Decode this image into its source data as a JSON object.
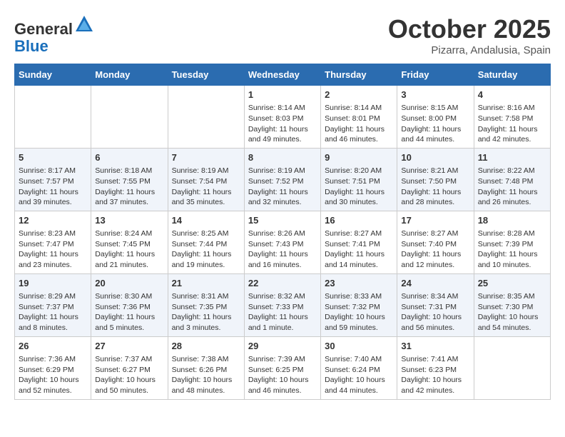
{
  "header": {
    "logo_general": "General",
    "logo_blue": "Blue",
    "month_title": "October 2025",
    "location": "Pizarra, Andalusia, Spain"
  },
  "weekdays": [
    "Sunday",
    "Monday",
    "Tuesday",
    "Wednesday",
    "Thursday",
    "Friday",
    "Saturday"
  ],
  "weeks": [
    [
      {
        "day": "",
        "info": ""
      },
      {
        "day": "",
        "info": ""
      },
      {
        "day": "",
        "info": ""
      },
      {
        "day": "1",
        "info": "Sunrise: 8:14 AM\nSunset: 8:03 PM\nDaylight: 11 hours and 49 minutes."
      },
      {
        "day": "2",
        "info": "Sunrise: 8:14 AM\nSunset: 8:01 PM\nDaylight: 11 hours and 46 minutes."
      },
      {
        "day": "3",
        "info": "Sunrise: 8:15 AM\nSunset: 8:00 PM\nDaylight: 11 hours and 44 minutes."
      },
      {
        "day": "4",
        "info": "Sunrise: 8:16 AM\nSunset: 7:58 PM\nDaylight: 11 hours and 42 minutes."
      }
    ],
    [
      {
        "day": "5",
        "info": "Sunrise: 8:17 AM\nSunset: 7:57 PM\nDaylight: 11 hours and 39 minutes."
      },
      {
        "day": "6",
        "info": "Sunrise: 8:18 AM\nSunset: 7:55 PM\nDaylight: 11 hours and 37 minutes."
      },
      {
        "day": "7",
        "info": "Sunrise: 8:19 AM\nSunset: 7:54 PM\nDaylight: 11 hours and 35 minutes."
      },
      {
        "day": "8",
        "info": "Sunrise: 8:19 AM\nSunset: 7:52 PM\nDaylight: 11 hours and 32 minutes."
      },
      {
        "day": "9",
        "info": "Sunrise: 8:20 AM\nSunset: 7:51 PM\nDaylight: 11 hours and 30 minutes."
      },
      {
        "day": "10",
        "info": "Sunrise: 8:21 AM\nSunset: 7:50 PM\nDaylight: 11 hours and 28 minutes."
      },
      {
        "day": "11",
        "info": "Sunrise: 8:22 AM\nSunset: 7:48 PM\nDaylight: 11 hours and 26 minutes."
      }
    ],
    [
      {
        "day": "12",
        "info": "Sunrise: 8:23 AM\nSunset: 7:47 PM\nDaylight: 11 hours and 23 minutes."
      },
      {
        "day": "13",
        "info": "Sunrise: 8:24 AM\nSunset: 7:45 PM\nDaylight: 11 hours and 21 minutes."
      },
      {
        "day": "14",
        "info": "Sunrise: 8:25 AM\nSunset: 7:44 PM\nDaylight: 11 hours and 19 minutes."
      },
      {
        "day": "15",
        "info": "Sunrise: 8:26 AM\nSunset: 7:43 PM\nDaylight: 11 hours and 16 minutes."
      },
      {
        "day": "16",
        "info": "Sunrise: 8:27 AM\nSunset: 7:41 PM\nDaylight: 11 hours and 14 minutes."
      },
      {
        "day": "17",
        "info": "Sunrise: 8:27 AM\nSunset: 7:40 PM\nDaylight: 11 hours and 12 minutes."
      },
      {
        "day": "18",
        "info": "Sunrise: 8:28 AM\nSunset: 7:39 PM\nDaylight: 11 hours and 10 minutes."
      }
    ],
    [
      {
        "day": "19",
        "info": "Sunrise: 8:29 AM\nSunset: 7:37 PM\nDaylight: 11 hours and 8 minutes."
      },
      {
        "day": "20",
        "info": "Sunrise: 8:30 AM\nSunset: 7:36 PM\nDaylight: 11 hours and 5 minutes."
      },
      {
        "day": "21",
        "info": "Sunrise: 8:31 AM\nSunset: 7:35 PM\nDaylight: 11 hours and 3 minutes."
      },
      {
        "day": "22",
        "info": "Sunrise: 8:32 AM\nSunset: 7:33 PM\nDaylight: 11 hours and 1 minute."
      },
      {
        "day": "23",
        "info": "Sunrise: 8:33 AM\nSunset: 7:32 PM\nDaylight: 10 hours and 59 minutes."
      },
      {
        "day": "24",
        "info": "Sunrise: 8:34 AM\nSunset: 7:31 PM\nDaylight: 10 hours and 56 minutes."
      },
      {
        "day": "25",
        "info": "Sunrise: 8:35 AM\nSunset: 7:30 PM\nDaylight: 10 hours and 54 minutes."
      }
    ],
    [
      {
        "day": "26",
        "info": "Sunrise: 7:36 AM\nSunset: 6:29 PM\nDaylight: 10 hours and 52 minutes."
      },
      {
        "day": "27",
        "info": "Sunrise: 7:37 AM\nSunset: 6:27 PM\nDaylight: 10 hours and 50 minutes."
      },
      {
        "day": "28",
        "info": "Sunrise: 7:38 AM\nSunset: 6:26 PM\nDaylight: 10 hours and 48 minutes."
      },
      {
        "day": "29",
        "info": "Sunrise: 7:39 AM\nSunset: 6:25 PM\nDaylight: 10 hours and 46 minutes."
      },
      {
        "day": "30",
        "info": "Sunrise: 7:40 AM\nSunset: 6:24 PM\nDaylight: 10 hours and 44 minutes."
      },
      {
        "day": "31",
        "info": "Sunrise: 7:41 AM\nSunset: 6:23 PM\nDaylight: 10 hours and 42 minutes."
      },
      {
        "day": "",
        "info": ""
      }
    ]
  ]
}
